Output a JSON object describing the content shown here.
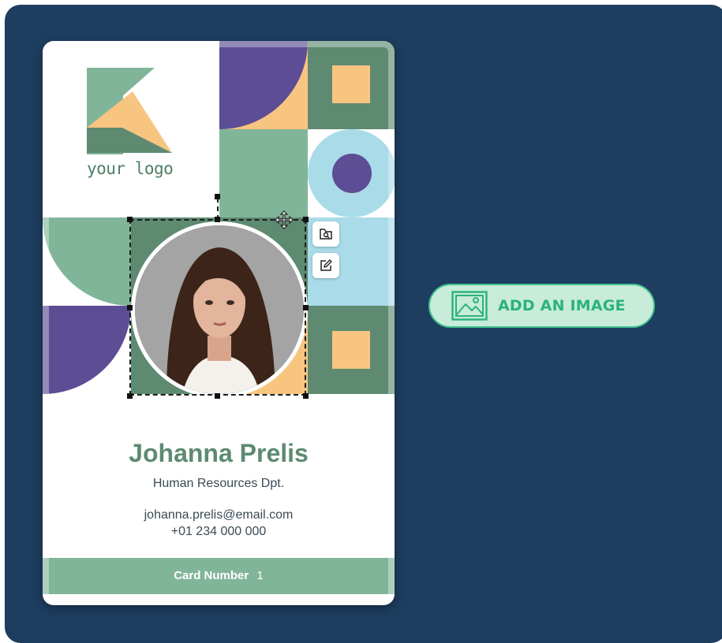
{
  "card": {
    "logo_text": "your logo",
    "name": "Johanna Prelis",
    "department": "Human Resources Dpt.",
    "email": "johanna.prelis@email.com",
    "phone": "+01 234 000 000",
    "card_number_label": "Card Number",
    "card_number_value": "1"
  },
  "toolbar": {
    "replace_icon": "replace-image-icon",
    "edit_icon": "edit-icon",
    "move_icon": "move-icon"
  },
  "add_image": {
    "label": "ADD AN IMAGE",
    "icon": "image-icon"
  },
  "colors": {
    "background": "#1e3e60",
    "green": "#81b59a",
    "dark_green": "#5d8a71",
    "purple": "#5c4d94",
    "peach": "#f8c581",
    "light_blue": "#a9dbe8",
    "accent": "#42c28f"
  }
}
